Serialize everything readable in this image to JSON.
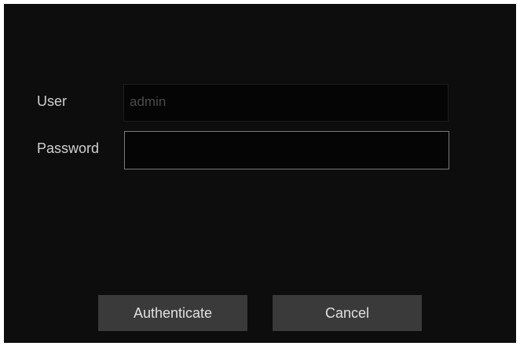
{
  "form": {
    "user_label": "User",
    "user_value": "admin",
    "password_label": "Password",
    "password_value": ""
  },
  "buttons": {
    "authenticate": "Authenticate",
    "cancel": "Cancel"
  },
  "colors": {
    "background": "#0d0d0d",
    "button": "#3a3a3a",
    "text": "#d0d0d0",
    "disabled_text": "#4a4a4a"
  }
}
